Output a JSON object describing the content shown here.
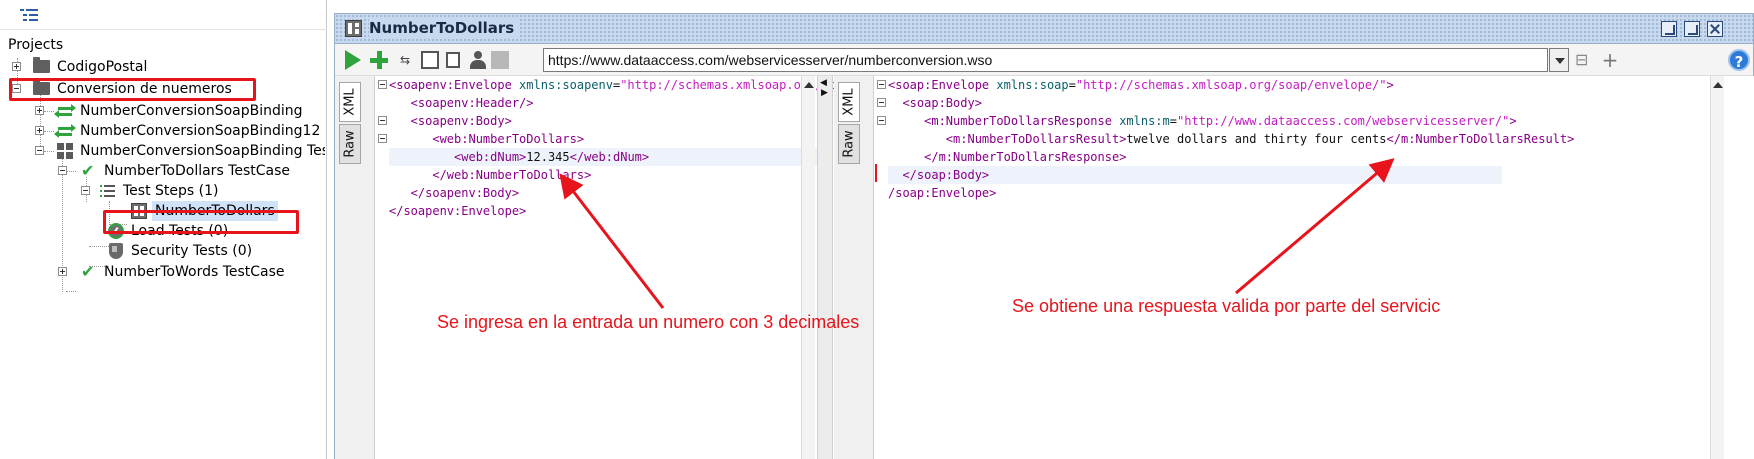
{
  "navigator": {
    "root_label": "Projects",
    "tree": [
      {
        "label": "CodigoPostal"
      },
      {
        "label": "Conversion de nuemeros"
      },
      {
        "label": "NumberConversionSoapBinding"
      },
      {
        "label": "NumberConversionSoapBinding12"
      },
      {
        "label": "NumberConversionSoapBinding Tes"
      },
      {
        "label": "NumberToDollars TestCase"
      },
      {
        "label": "Test Steps (1)"
      },
      {
        "label": "NumberToDollars"
      },
      {
        "label": "Load Tests (0)"
      },
      {
        "label": "Security Tests (0)"
      },
      {
        "label": "NumberToWords TestCase"
      }
    ]
  },
  "editor": {
    "title": "NumberToDollars",
    "endpoint_url": "https://www.dataaccess.com/webservicesserver/numberconversion.wso",
    "request_tabs": [
      "XML",
      "Raw"
    ],
    "response_tabs": [
      "XML",
      "Raw"
    ],
    "request_xml": [
      {
        "parts": [
          {
            "c": "tag",
            "t": "<soapenv:Envelope "
          },
          {
            "c": "attr",
            "t": "xmlns:soapenv"
          },
          {
            "c": "txt",
            "t": "="
          },
          {
            "c": "val",
            "t": "\"http://schemas.xmlsoap.org/soap"
          }
        ]
      },
      {
        "parts": [
          {
            "c": "tag",
            "t": "   <soapenv:Header/>"
          }
        ]
      },
      {
        "parts": [
          {
            "c": "tag",
            "t": "   <soapenv:Body>"
          }
        ]
      },
      {
        "parts": [
          {
            "c": "tag",
            "t": "      <web:NumberToDollars>"
          }
        ]
      },
      {
        "parts": [
          {
            "c": "tag",
            "t": "         <web:dNum>"
          },
          {
            "c": "txt",
            "t": "12.345"
          },
          {
            "c": "tag",
            "t": "</web:dNum>"
          }
        ]
      },
      {
        "parts": [
          {
            "c": "tag",
            "t": "      </web:NumberToDollars>"
          }
        ]
      },
      {
        "parts": [
          {
            "c": "tag",
            "t": "   </soapenv:Body>"
          }
        ]
      },
      {
        "parts": [
          {
            "c": "tag",
            "t": "</soapenv:Envelope>"
          }
        ]
      }
    ],
    "response_xml": [
      {
        "parts": [
          {
            "c": "tag",
            "t": "<soap:Envelope "
          },
          {
            "c": "attr",
            "t": "xmlns:soap"
          },
          {
            "c": "txt",
            "t": "="
          },
          {
            "c": "val",
            "t": "\"http://schemas.xmlsoap.org/soap/envelope/\""
          },
          {
            "c": "tag",
            "t": ">"
          }
        ]
      },
      {
        "parts": [
          {
            "c": "tag",
            "t": "  <soap:Body>"
          }
        ]
      },
      {
        "parts": [
          {
            "c": "tag",
            "t": "     <m:NumberToDollarsResponse "
          },
          {
            "c": "attr",
            "t": "xmlns:m"
          },
          {
            "c": "txt",
            "t": "="
          },
          {
            "c": "val",
            "t": "\"http://www.dataaccess.com/webservicesserver/\""
          },
          {
            "c": "tag",
            "t": ">"
          }
        ]
      },
      {
        "parts": [
          {
            "c": "tag",
            "t": "        <m:NumberToDollarsResult>"
          },
          {
            "c": "txt",
            "t": "twelve dollars and thirty four cents"
          },
          {
            "c": "tag",
            "t": "</m:NumberToDollarsResult>"
          }
        ]
      },
      {
        "parts": [
          {
            "c": "tag",
            "t": "     </m:NumberToDollarsResponse>"
          }
        ]
      },
      {
        "parts": [
          {
            "c": "tag",
            "t": "  </soap:Body>"
          }
        ]
      },
      {
        "parts": [
          {
            "c": "tag",
            "t": "/soap:Envelope>"
          }
        ]
      }
    ]
  },
  "annotations": {
    "left": "Se ingresa en la entrada un numero con 3 decimales",
    "right": "Se obtiene una respuesta valida por parte del servicic"
  },
  "colors": {
    "annotation": "#e8141c",
    "run": "#2fa33c",
    "titlebar": "#c7d9ef"
  }
}
